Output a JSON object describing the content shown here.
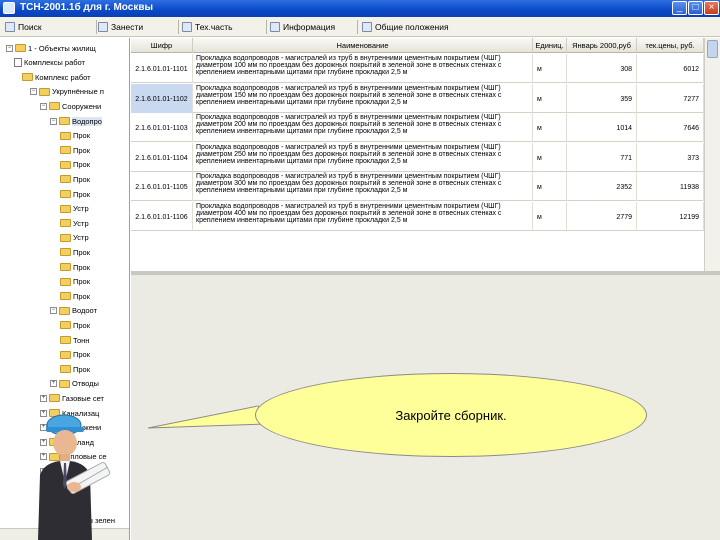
{
  "window": {
    "title": "ТСН-2001.1б для г. Москвы",
    "buttons": [
      "_",
      "□",
      "×"
    ]
  },
  "toolbar": {
    "items": [
      "Поиск",
      "Занести",
      "Тех.часть",
      "Информация",
      "Общие положения"
    ]
  },
  "tree": {
    "items": [
      {
        "label": "1 - Объекты жилищ",
        "kind": "root"
      },
      {
        "label": "Комплексы работ",
        "kind": "doc"
      },
      {
        "label": "Комплекс работ",
        "kind": "folder"
      },
      {
        "label": "Укрупнённые п",
        "kind": "folder"
      },
      {
        "label": "Сооружени",
        "kind": "folder"
      },
      {
        "label": "Водопро",
        "kind": "folder"
      },
      {
        "label": "Прок",
        "kind": "folder"
      },
      {
        "label": "Прок",
        "kind": "folder"
      },
      {
        "label": "Прок",
        "kind": "folder"
      },
      {
        "label": "Прок",
        "kind": "folder"
      },
      {
        "label": "Прок",
        "kind": "folder"
      },
      {
        "label": "Устр",
        "kind": "folder"
      },
      {
        "label": "Устр",
        "kind": "folder"
      },
      {
        "label": "Устр",
        "kind": "folder"
      },
      {
        "label": "Прок",
        "kind": "folder"
      },
      {
        "label": "Прок",
        "kind": "folder"
      },
      {
        "label": "Прок",
        "kind": "folder"
      },
      {
        "label": "Прок",
        "kind": "folder"
      },
      {
        "label": "Водоот",
        "kind": "folder"
      },
      {
        "label": "Прок",
        "kind": "folder"
      },
      {
        "label": "Тонн",
        "kind": "folder"
      },
      {
        "label": "Прок",
        "kind": "folder"
      },
      {
        "label": "Прок",
        "kind": "folder"
      },
      {
        "label": "Отводы",
        "kind": "folder"
      },
      {
        "label": "Газовые сет",
        "kind": "folder"
      },
      {
        "label": "Канализац",
        "kind": "folder"
      },
      {
        "label": "Сооружени",
        "kind": "folder"
      },
      {
        "label": "Арх.ланд",
        "kind": "folder"
      },
      {
        "label": "Тепловые се",
        "kind": "folder"
      },
      {
        "label": "Уличн.и ж",
        "kind": "folder"
      }
    ],
    "bottom_item": "Объекты зелен"
  },
  "grid": {
    "columns": [
      "Шифр",
      "Наименование",
      "Единиц.",
      "Январь 2000,руб",
      "тек.цены, руб."
    ],
    "rows": [
      {
        "code": "2.1.6.01.01-1101",
        "name": "Прокладка водопроводов - магистралей из труб в внутренними цементным покрытием (ЧШГ) диаметром 100 мм по проездам без дорожных покрытий в зеленой зоне в отвесных стенках с креплением инвентарными щитами при глубине прокладки 2,5 м",
        "unit": "м",
        "v1": "308",
        "v2": "6012"
      },
      {
        "code": "2.1.6.01.01-1102",
        "name": "Прокладка водопроводов - магистралей из труб в внутренними цементным покрытием (ЧШГ) диаметром 150 мм по проездам без дорожных покрытий в зеленой зоне в отвесных стенках с креплением инвентарными щитами при глубине прокладки 2,5 м",
        "unit": "м",
        "v1": "359",
        "v2": "7277"
      },
      {
        "code": "2.1.6.01.01-1103",
        "name": "Прокладка водопроводов - магистралей из труб в внутренними цементным покрытием (ЧШГ) диаметром 200 мм по проездам без дорожных покрытий в зеленой зоне в отвесных стенках с креплением инвентарными щитами при глубине прокладки 2,5 м",
        "unit": "м",
        "v1": "1014",
        "v2": "7646"
      },
      {
        "code": "2.1.6.01.01-1104",
        "name": "Прокладка водопроводов - магистралей из труб в внутренними цементным покрытием (ЧШГ) диаметром 250 мм по проездам без дорожных покрытий в зеленой зоне в отвесных стенках с креплением инвентарными щитами при глубине прокладки 2,5 м",
        "unit": "м",
        "v1": "771",
        "v2": "373"
      },
      {
        "code": "2.1.6.01.01-1105",
        "name": "Прокладка водопроводов - магистралей из труб в внутренними цементным покрытием (ЧШГ) диаметром 300 мм по проездам без дорожных покрытий в зеленой зоне в отвесных стенках с креплением инвентарными щитами при глубине прокладки 2,5 м",
        "unit": "м",
        "v1": "2352",
        "v2": "11938"
      },
      {
        "code": "2.1.6.01.01-1106",
        "name": "Прокладка водопроводов - магистралей из труб в внутренними цементным покрытием (ЧШГ) диаметром 400 мм по проездам без дорожных покрытий в зеленой зоне в отвесных стенках с креплением инвентарными щитами при глубине прокладки 2,5 м",
        "unit": "м",
        "v1": "2779",
        "v2": "12199"
      }
    ],
    "selected_row": 1
  },
  "callout": {
    "text": "Закройте сборник."
  },
  "colors": {
    "titlebar": "#0a49c8",
    "bubble": "#ffff9a",
    "selection": "#c9d9f0",
    "pane_bg": "#ebeae3"
  },
  "icons": {
    "window_minimize": "minimize-icon",
    "window_maximize": "maximize-icon",
    "window_close": "close-icon"
  }
}
